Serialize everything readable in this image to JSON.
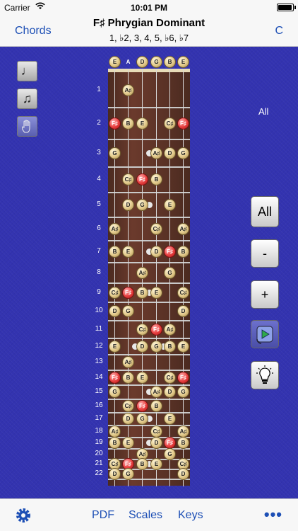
{
  "status": {
    "carrier": "Carrier",
    "time": "10:01 PM"
  },
  "nav": {
    "left": "Chords",
    "title": "F♯ Phrygian Dominant",
    "subtitle": "1, ♭2, 3, 4, 5, ♭6, ♭7",
    "right": "C"
  },
  "scope_label": "All",
  "right_buttons": {
    "all": "All",
    "minus": "-",
    "plus": "+"
  },
  "tabs": {
    "pdf": "PDF",
    "scales": "Scales",
    "keys": "Keys",
    "more": "•••"
  },
  "open_strings": [
    "E",
    "A",
    "D",
    "G",
    "B",
    "E"
  ],
  "fret_numbers": [
    "1",
    "2",
    "3",
    "4",
    "5",
    "6",
    "7",
    "8",
    "9",
    "10",
    "11",
    "12",
    "13",
    "14",
    "15",
    "16",
    "17",
    "18",
    "19",
    "20",
    "21",
    "22"
  ],
  "fret_notes": [
    {
      "fret": 1,
      "string": 1,
      "label": "A♯"
    },
    {
      "fret": 2,
      "string": 0,
      "label": "F♯",
      "root": true
    },
    {
      "fret": 2,
      "string": 1,
      "label": "B"
    },
    {
      "fret": 2,
      "string": 2,
      "label": "E"
    },
    {
      "fret": 2,
      "string": 4,
      "label": "C♯"
    },
    {
      "fret": 2,
      "string": 5,
      "label": "F♯",
      "root": true
    },
    {
      "fret": 3,
      "string": 0,
      "label": "G"
    },
    {
      "fret": 3,
      "string": 3,
      "label": "A♯"
    },
    {
      "fret": 3,
      "string": 4,
      "label": "D"
    },
    {
      "fret": 3,
      "string": 5,
      "label": "G"
    },
    {
      "fret": 4,
      "string": 1,
      "label": "C♯"
    },
    {
      "fret": 4,
      "string": 2,
      "label": "F♯",
      "root": true
    },
    {
      "fret": 4,
      "string": 3,
      "label": "B"
    },
    {
      "fret": 5,
      "string": 1,
      "label": "D"
    },
    {
      "fret": 5,
      "string": 2,
      "label": "G"
    },
    {
      "fret": 5,
      "string": 4,
      "label": "E"
    },
    {
      "fret": 6,
      "string": 0,
      "label": "A♯"
    },
    {
      "fret": 6,
      "string": 3,
      "label": "C♯"
    },
    {
      "fret": 6,
      "string": 5,
      "label": "A♯"
    },
    {
      "fret": 7,
      "string": 0,
      "label": "B"
    },
    {
      "fret": 7,
      "string": 1,
      "label": "E"
    },
    {
      "fret": 7,
      "string": 3,
      "label": "D"
    },
    {
      "fret": 7,
      "string": 4,
      "label": "F♯",
      "root": true
    },
    {
      "fret": 7,
      "string": 5,
      "label": "B"
    },
    {
      "fret": 8,
      "string": 2,
      "label": "A♯"
    },
    {
      "fret": 8,
      "string": 4,
      "label": "G"
    },
    {
      "fret": 9,
      "string": 0,
      "label": "C♯"
    },
    {
      "fret": 9,
      "string": 1,
      "label": "F♯",
      "root": true
    },
    {
      "fret": 9,
      "string": 2,
      "label": "B"
    },
    {
      "fret": 9,
      "string": 3,
      "label": "E"
    },
    {
      "fret": 9,
      "string": 5,
      "label": "C♯"
    },
    {
      "fret": 10,
      "string": 0,
      "label": "D"
    },
    {
      "fret": 10,
      "string": 1,
      "label": "G"
    },
    {
      "fret": 10,
      "string": 5,
      "label": "D"
    },
    {
      "fret": 11,
      "string": 2,
      "label": "C♯"
    },
    {
      "fret": 11,
      "string": 3,
      "label": "F♯",
      "root": true
    },
    {
      "fret": 11,
      "string": 4,
      "label": "A♯"
    },
    {
      "fret": 12,
      "string": 0,
      "label": "E"
    },
    {
      "fret": 12,
      "string": 2,
      "label": "D"
    },
    {
      "fret": 12,
      "string": 3,
      "label": "G"
    },
    {
      "fret": 12,
      "string": 4,
      "label": "B"
    },
    {
      "fret": 12,
      "string": 5,
      "label": "E"
    },
    {
      "fret": 13,
      "string": 1,
      "label": "A♯"
    },
    {
      "fret": 14,
      "string": 0,
      "label": "F♯",
      "root": true
    },
    {
      "fret": 14,
      "string": 1,
      "label": "B"
    },
    {
      "fret": 14,
      "string": 2,
      "label": "E"
    },
    {
      "fret": 14,
      "string": 4,
      "label": "C♯"
    },
    {
      "fret": 14,
      "string": 5,
      "label": "F♯",
      "root": true
    },
    {
      "fret": 15,
      "string": 0,
      "label": "G"
    },
    {
      "fret": 15,
      "string": 3,
      "label": "A♯"
    },
    {
      "fret": 15,
      "string": 4,
      "label": "D"
    },
    {
      "fret": 15,
      "string": 5,
      "label": "G"
    },
    {
      "fret": 16,
      "string": 1,
      "label": "C♯"
    },
    {
      "fret": 16,
      "string": 2,
      "label": "F♯",
      "root": true
    },
    {
      "fret": 16,
      "string": 3,
      "label": "B"
    },
    {
      "fret": 17,
      "string": 1,
      "label": "D"
    },
    {
      "fret": 17,
      "string": 2,
      "label": "G"
    },
    {
      "fret": 17,
      "string": 4,
      "label": "E"
    },
    {
      "fret": 18,
      "string": 0,
      "label": "A♯"
    },
    {
      "fret": 18,
      "string": 3,
      "label": "C♯"
    },
    {
      "fret": 18,
      "string": 5,
      "label": "A♯"
    },
    {
      "fret": 19,
      "string": 0,
      "label": "B"
    },
    {
      "fret": 19,
      "string": 1,
      "label": "E"
    },
    {
      "fret": 19,
      "string": 3,
      "label": "D"
    },
    {
      "fret": 19,
      "string": 4,
      "label": "F♯",
      "root": true
    },
    {
      "fret": 19,
      "string": 5,
      "label": "B"
    },
    {
      "fret": 20,
      "string": 2,
      "label": "A♯"
    },
    {
      "fret": 20,
      "string": 4,
      "label": "G"
    },
    {
      "fret": 21,
      "string": 0,
      "label": "C♯"
    },
    {
      "fret": 21,
      "string": 1,
      "label": "F♯",
      "root": true
    },
    {
      "fret": 21,
      "string": 2,
      "label": "B"
    },
    {
      "fret": 21,
      "string": 3,
      "label": "E"
    },
    {
      "fret": 21,
      "string": 5,
      "label": "C♯"
    },
    {
      "fret": 22,
      "string": 0,
      "label": "D"
    },
    {
      "fret": 22,
      "string": 1,
      "label": "G"
    },
    {
      "fret": 22,
      "string": 5,
      "label": "D"
    }
  ]
}
